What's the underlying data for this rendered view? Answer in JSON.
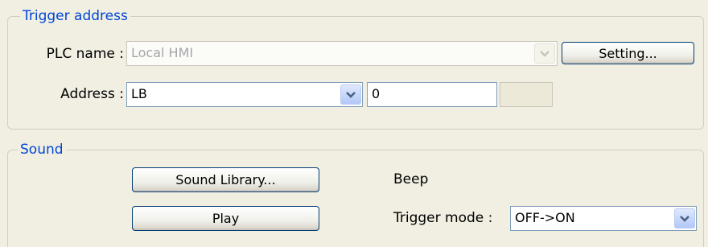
{
  "trigger_address": {
    "title": "Trigger address",
    "plc_name_label": "PLC name :",
    "plc_name_value": "Local HMI",
    "setting_button": "Setting...",
    "address_label": "Address :",
    "address_type": "LB",
    "address_value": "0"
  },
  "sound": {
    "title": "Sound",
    "sound_library_button": "Sound Library...",
    "sound_name": "Beep",
    "play_button": "Play",
    "trigger_mode_label": "Trigger mode :",
    "trigger_mode_value": "OFF->ON"
  },
  "icons": {
    "dropdown": "chevron-down-icon"
  },
  "colors": {
    "background": "#f1efe2",
    "group_title": "#0046d5",
    "field_border": "#7f9db9",
    "button_border": "#003c74"
  }
}
